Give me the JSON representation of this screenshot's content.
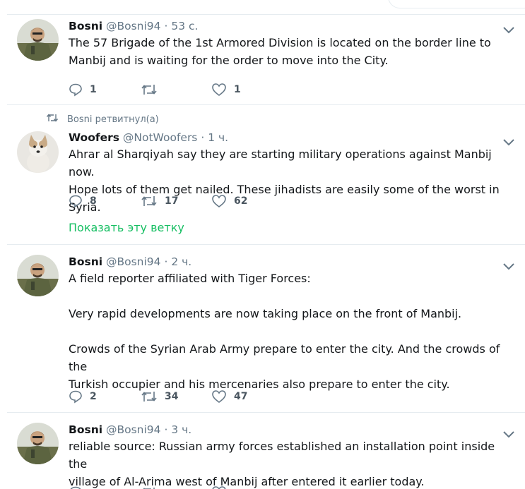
{
  "tweets": [
    {
      "name": "Bosni",
      "handle": "@Bosni94",
      "time": "53 с.",
      "text": "The 57 Brigade of the 1st Armored Division is located on the border line to\nManbij and is waiting for the order to move into the City.",
      "replies": "1",
      "retweets": "",
      "likes": "1"
    },
    {
      "retweeted_by": "Bosni ретвитнул(а)",
      "name": "Woofers",
      "handle": "@NotWoofers",
      "time": "1 ч.",
      "text": "Ahrar al Sharqiyah say they are starting military operations against Manbij now.\nHope lots of them get nailed. These jihadists are easily some of the worst in Syria.",
      "replies": "8",
      "retweets": "17",
      "likes": "62",
      "show_thread": "Показать эту ветку"
    },
    {
      "name": "Bosni",
      "handle": "@Bosni94",
      "time": "2 ч.",
      "text": "A field reporter affiliated with Tiger Forces:\n\nVery rapid developments are now taking place on the front of Manbij.\n\nCrowds of the Syrian Arab Army prepare to enter the city. And the crowds of the\nTurkish occupier and his mercenaries also prepare to enter the city.",
      "replies": "2",
      "retweets": "34",
      "likes": "47"
    },
    {
      "name": "Bosni",
      "handle": "@Bosni94",
      "time": "3 ч.",
      "text": "reliable source: Russian army forces established an installation point inside the\nvillage of Al-Arima west of Manbij after entered it earlier today.",
      "replies": "",
      "retweets": "",
      "likes": ""
    }
  ],
  "separator": "·",
  "colors": {
    "text": "#14171a",
    "muted": "#657786",
    "green": "#17bf63",
    "border": "#e6ecf0"
  },
  "icons": [
    "reply-icon",
    "retweet-icon",
    "like-icon",
    "chevron-down-icon"
  ]
}
